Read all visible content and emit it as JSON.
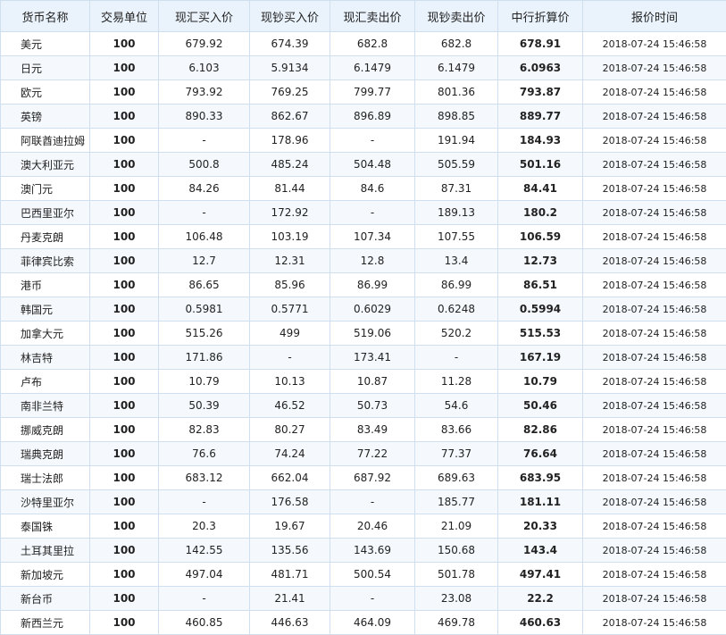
{
  "table": {
    "headers": [
      "货币名称",
      "交易单位",
      "现汇买入价",
      "现钞买入价",
      "现汇卖出价",
      "现钞卖出价",
      "中行折算价",
      "报价时间"
    ],
    "rows": [
      [
        "美元",
        "100",
        "679.92",
        "674.39",
        "682.8",
        "682.8",
        "678.91",
        "2018-07-24 15:46:58"
      ],
      [
        "日元",
        "100",
        "6.103",
        "5.9134",
        "6.1479",
        "6.1479",
        "6.0963",
        "2018-07-24 15:46:58"
      ],
      [
        "欧元",
        "100",
        "793.92",
        "769.25",
        "799.77",
        "801.36",
        "793.87",
        "2018-07-24 15:46:58"
      ],
      [
        "英镑",
        "100",
        "890.33",
        "862.67",
        "896.89",
        "898.85",
        "889.77",
        "2018-07-24 15:46:58"
      ],
      [
        "阿联酋迪拉姆",
        "100",
        "-",
        "178.96",
        "-",
        "191.94",
        "184.93",
        "2018-07-24 15:46:58"
      ],
      [
        "澳大利亚元",
        "100",
        "500.8",
        "485.24",
        "504.48",
        "505.59",
        "501.16",
        "2018-07-24 15:46:58"
      ],
      [
        "澳门元",
        "100",
        "84.26",
        "81.44",
        "84.6",
        "87.31",
        "84.41",
        "2018-07-24 15:46:58"
      ],
      [
        "巴西里亚尔",
        "100",
        "-",
        "172.92",
        "-",
        "189.13",
        "180.2",
        "2018-07-24 15:46:58"
      ],
      [
        "丹麦克朗",
        "100",
        "106.48",
        "103.19",
        "107.34",
        "107.55",
        "106.59",
        "2018-07-24 15:46:58"
      ],
      [
        "菲律宾比索",
        "100",
        "12.7",
        "12.31",
        "12.8",
        "13.4",
        "12.73",
        "2018-07-24 15:46:58"
      ],
      [
        "港币",
        "100",
        "86.65",
        "85.96",
        "86.99",
        "86.99",
        "86.51",
        "2018-07-24 15:46:58"
      ],
      [
        "韩国元",
        "100",
        "0.5981",
        "0.5771",
        "0.6029",
        "0.6248",
        "0.5994",
        "2018-07-24 15:46:58"
      ],
      [
        "加拿大元",
        "100",
        "515.26",
        "499",
        "519.06",
        "520.2",
        "515.53",
        "2018-07-24 15:46:58"
      ],
      [
        "林吉特",
        "100",
        "171.86",
        "-",
        "173.41",
        "-",
        "167.19",
        "2018-07-24 15:46:58"
      ],
      [
        "卢布",
        "100",
        "10.79",
        "10.13",
        "10.87",
        "11.28",
        "10.79",
        "2018-07-24 15:46:58"
      ],
      [
        "南非兰特",
        "100",
        "50.39",
        "46.52",
        "50.73",
        "54.6",
        "50.46",
        "2018-07-24 15:46:58"
      ],
      [
        "挪威克朗",
        "100",
        "82.83",
        "80.27",
        "83.49",
        "83.66",
        "82.86",
        "2018-07-24 15:46:58"
      ],
      [
        "瑞典克朗",
        "100",
        "76.6",
        "74.24",
        "77.22",
        "77.37",
        "76.64",
        "2018-07-24 15:46:58"
      ],
      [
        "瑞士法郎",
        "100",
        "683.12",
        "662.04",
        "687.92",
        "689.63",
        "683.95",
        "2018-07-24 15:46:58"
      ],
      [
        "沙特里亚尔",
        "100",
        "-",
        "176.58",
        "-",
        "185.77",
        "181.11",
        "2018-07-24 15:46:58"
      ],
      [
        "泰国铢",
        "100",
        "20.3",
        "19.67",
        "20.46",
        "21.09",
        "20.33",
        "2018-07-24 15:46:58"
      ],
      [
        "土耳其里拉",
        "100",
        "142.55",
        "135.56",
        "143.69",
        "150.68",
        "143.4",
        "2018-07-24 15:46:58"
      ],
      [
        "新加坡元",
        "100",
        "497.04",
        "481.71",
        "500.54",
        "501.78",
        "497.41",
        "2018-07-24 15:46:58"
      ],
      [
        "新台币",
        "100",
        "-",
        "21.41",
        "-",
        "23.08",
        "22.2",
        "2018-07-24 15:46:58"
      ],
      [
        "新西兰元",
        "100",
        "460.85",
        "446.63",
        "464.09",
        "469.78",
        "460.63",
        "2018-07-24 15:46:58"
      ]
    ]
  }
}
